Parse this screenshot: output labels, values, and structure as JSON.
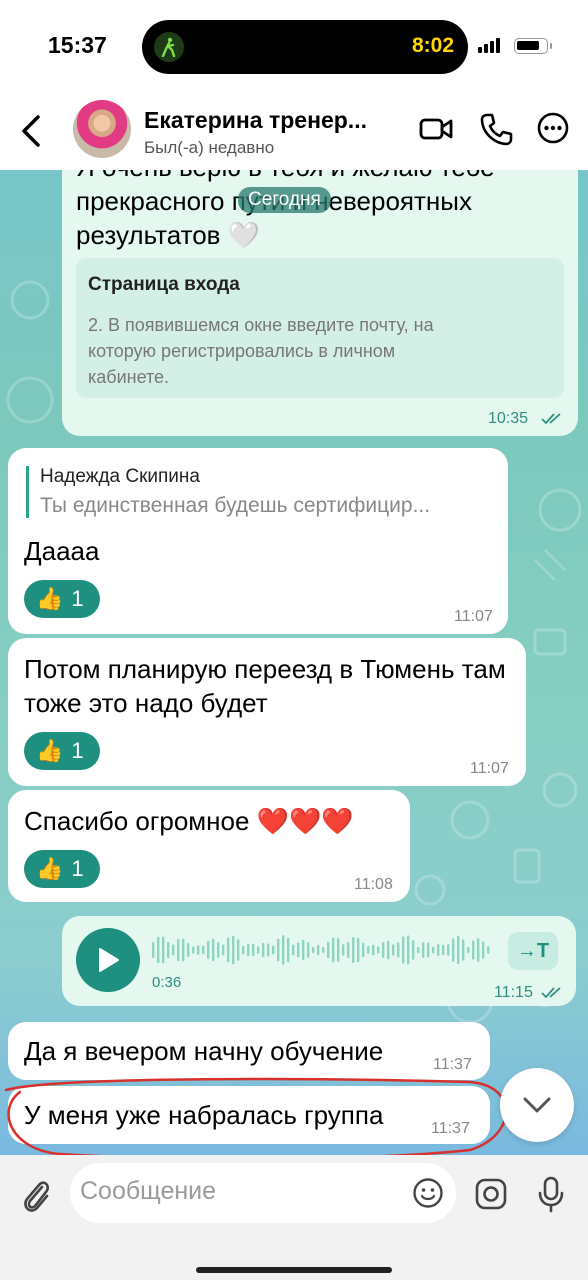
{
  "status_bar": {
    "time": "15:37",
    "island_time": "8:02"
  },
  "header": {
    "contact_name": "Екатерина тренер...",
    "last_seen": "Был(-а) недавно"
  },
  "chat": {
    "date_label": "Сегодня",
    "messages": [
      {
        "direction": "out",
        "text": "Я очень верю в тебя и желаю тебе прекрасного пути и невероятных результатов 🤍",
        "link_preview": {
          "title": "Страница входа",
          "description": "2. В появившемся окне введите почту, на которую регистрировались в личном кабинете."
        },
        "time": "10:35"
      },
      {
        "direction": "in",
        "reply_author": "Надежда Скипина",
        "reply_text": "Ты единственная будешь сертифицир...",
        "text": "Даааа",
        "reaction": {
          "emoji": "👍",
          "count": "1"
        },
        "time": "11:07"
      },
      {
        "direction": "in",
        "text": "Потом планирую переезд в Тюмень там тоже это надо будет",
        "reaction": {
          "emoji": "👍",
          "count": "1"
        },
        "time": "11:07"
      },
      {
        "direction": "in",
        "text": "Спасибо огромное ❤️❤️❤️",
        "reaction": {
          "emoji": "👍",
          "count": "1"
        },
        "time": "11:08"
      },
      {
        "direction": "out",
        "type": "voice",
        "duration": "0:36",
        "transcribe_label": "→T",
        "time": "11:15"
      },
      {
        "direction": "in",
        "text": "Да я вечером начну обучение",
        "time": "11:37"
      },
      {
        "direction": "in",
        "text": "У меня уже набралась группа",
        "time": "11:37"
      }
    ]
  },
  "input": {
    "placeholder": "Сообщение"
  },
  "colors": {
    "accent": "#1f8f80",
    "outgoing_bubble": "#e4f8ef",
    "incoming_bubble": "#ffffff",
    "annotation_red": "#d9302c"
  },
  "icons": [
    "walk-icon",
    "back-icon",
    "video-call-icon",
    "phone-icon",
    "more-icon",
    "play-icon",
    "double-check-icon",
    "chevron-down-icon",
    "attach-icon",
    "emoji-icon",
    "camera-icon",
    "microphone-icon"
  ]
}
